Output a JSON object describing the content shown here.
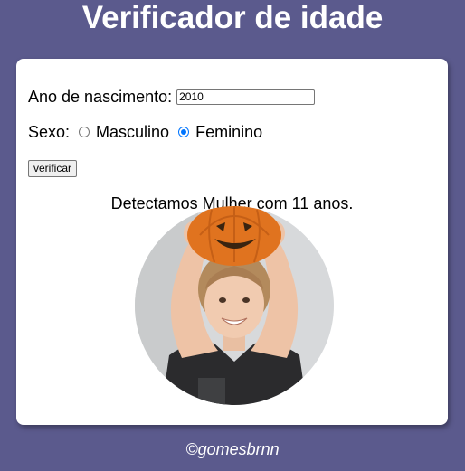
{
  "header": {
    "title": "Verificador de idade"
  },
  "form": {
    "year_label": "Ano de nascimento:",
    "year_value": "2010",
    "sex_label": "Sexo:",
    "sex_options": [
      {
        "label": "Masculino",
        "checked": false
      },
      {
        "label": "Feminino",
        "checked": true
      }
    ],
    "submit_label": "verificar"
  },
  "result": {
    "message": "Detectamos Mulher com 11 anos.",
    "image_subject": "girl-with-pumpkin-photo"
  },
  "footer": {
    "credit": "©gomesbrnn"
  },
  "colors": {
    "background": "#5b5a8d",
    "card": "#ffffff",
    "radio_accent": "#0075ff"
  }
}
